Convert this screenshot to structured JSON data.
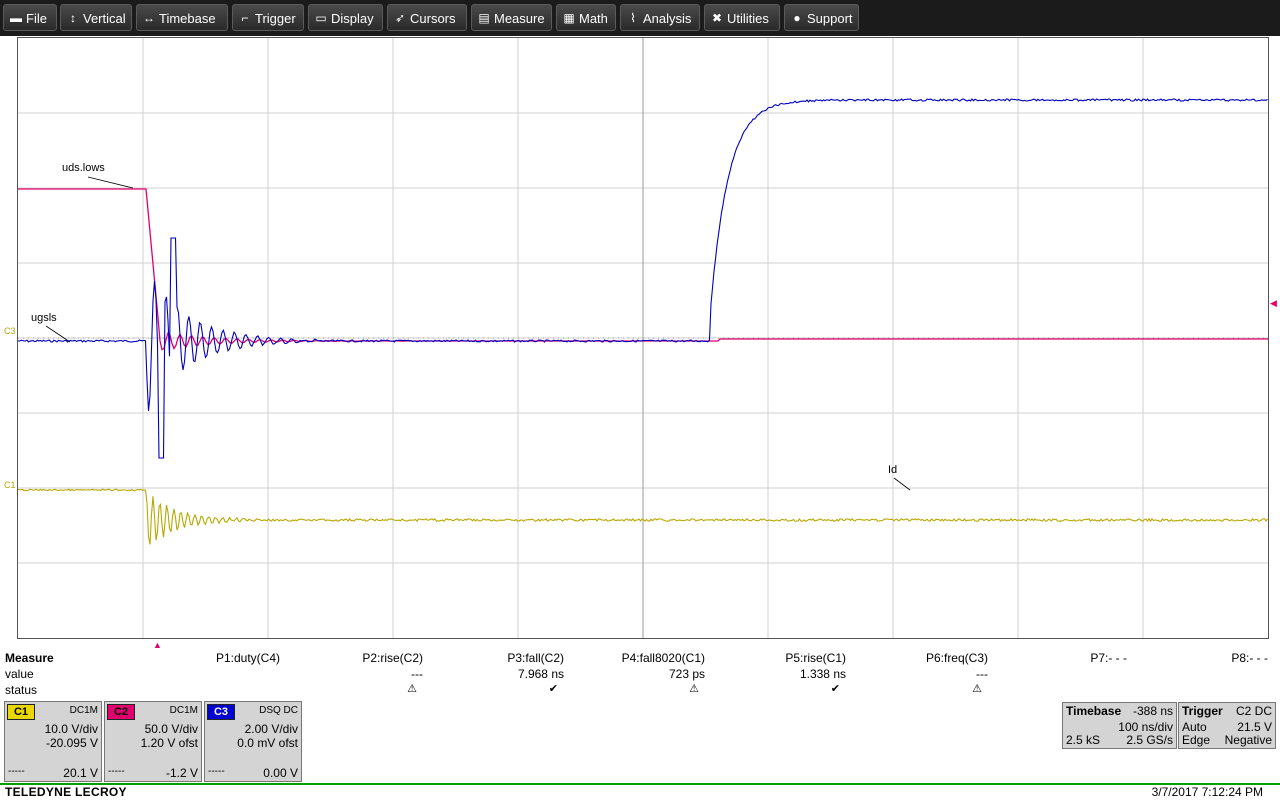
{
  "menu": [
    {
      "label": "File",
      "icon": "folder-icon",
      "glyph": "▬"
    },
    {
      "label": "Vertical",
      "icon": "vertical-arrows-icon",
      "glyph": "↕"
    },
    {
      "label": "Timebase",
      "icon": "horizontal-arrows-icon",
      "glyph": "↔"
    },
    {
      "label": "Trigger",
      "icon": "trigger-edge-icon",
      "glyph": "⌐"
    },
    {
      "label": "Display",
      "icon": "display-icon",
      "glyph": "▭"
    },
    {
      "label": "Cursors",
      "icon": "cursor-icon",
      "glyph": "➶"
    },
    {
      "label": "Measure",
      "icon": "measure-icon",
      "glyph": "▤"
    },
    {
      "label": "Math",
      "icon": "calculator-icon",
      "glyph": "▦"
    },
    {
      "label": "Analysis",
      "icon": "chart-icon",
      "glyph": "⌇"
    },
    {
      "label": "Utilities",
      "icon": "tools-icon",
      "glyph": "✖"
    },
    {
      "label": "Support",
      "icon": "info-icon",
      "glyph": "●"
    }
  ],
  "traces": {
    "label_uds": "uds.lows",
    "label_ugs": "ugsls",
    "label_id": "Id",
    "marker_c1": "C1",
    "marker_c3": "C3",
    "colors": {
      "c1": "#b8a800",
      "c2": "#e0006e",
      "c3": "#0000c0"
    }
  },
  "measure": {
    "title": "Measure",
    "row_value": "value",
    "row_status": "status",
    "params": [
      {
        "name": "P1:duty(C4)",
        "value": "",
        "status": ""
      },
      {
        "name": "P2:rise(C2)",
        "value": "---",
        "status": "⚠"
      },
      {
        "name": "P3:fall(C2)",
        "value": "7.968 ns",
        "status": "✔"
      },
      {
        "name": "P4:fall8020(C1)",
        "value": "723 ps",
        "status": "⚠"
      },
      {
        "name": "P5:rise(C1)",
        "value": "1.338 ns",
        "status": "✔"
      },
      {
        "name": "P6:freq(C3)",
        "value": "---",
        "status": "⚠"
      },
      {
        "name": "P7:- - -",
        "value": "",
        "status": ""
      },
      {
        "name": "P8:- - -",
        "value": "",
        "status": ""
      }
    ]
  },
  "channels": [
    {
      "tag": "C1",
      "color": "#e8d800",
      "coupling": "DC1M",
      "vdiv": "10.0 V/div",
      "offset": "-20.095 V",
      "foot_left": "-----",
      "foot_right": "20.1 V"
    },
    {
      "tag": "C2",
      "color": "#e0006e",
      "coupling": "DC1M",
      "vdiv": "50.0 V/div",
      "offset": "1.20 V ofst",
      "foot_left": "-----",
      "foot_right": "-1.2 V"
    },
    {
      "tag": "C3",
      "color": "#0000d0",
      "coupling": "DSQ DC",
      "vdiv": "2.00 V/div",
      "offset": "0.0 mV ofst",
      "foot_left": "-----",
      "foot_right": "0.00 V"
    }
  ],
  "timebase": {
    "title": "Timebase",
    "delay": "-388 ns",
    "per_div": "100 ns/div",
    "samples": "2.5 kS",
    "rate": "2.5 GS/s"
  },
  "trigger": {
    "title": "Trigger",
    "source": "C2 DC",
    "mode": "Auto",
    "level": "21.5 V",
    "type": "Edge",
    "slope": "Negative"
  },
  "footer": {
    "brand": "TELEDYNE LECROY",
    "datetime": "3/7/2017 7:12:24 PM"
  }
}
